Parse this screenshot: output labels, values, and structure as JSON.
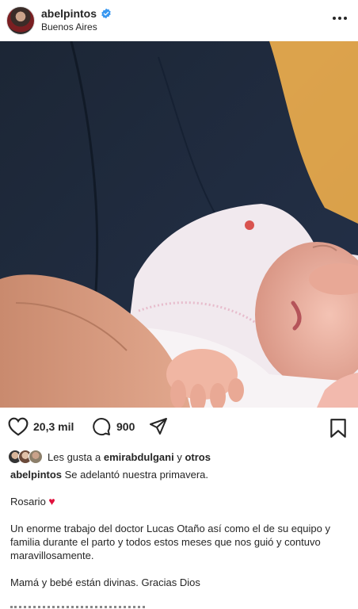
{
  "post": {
    "username": "abelpintos",
    "location": "Buenos Aires",
    "verified": true
  },
  "actions": {
    "like_count": "20,3 mil",
    "comment_count": "900"
  },
  "likes": {
    "prefix": "Les gusta a",
    "user": "emirabdulgani",
    "connector": "y",
    "others": "otros"
  },
  "caption": {
    "username": "abelpintos",
    "line1": "Se adelantó nuestra primavera.",
    "line2": "Rosario",
    "line3": "Un enorme trabajo del doctor Lucas Otaño  así como el de su equipo y familia durante el parto y todos estos meses que nos guió y contuvo maravillosamente.",
    "line4": "Mamá y bebé están divinas. Gracias Dios"
  },
  "colors": {
    "verified": "#3897f0",
    "heart": "#e0103c",
    "text": "#262626"
  },
  "icons": [
    "verified-badge-icon",
    "more-options-icon",
    "heart-icon",
    "comment-icon",
    "share-icon",
    "bookmark-icon",
    "red-heart-emoji"
  ]
}
